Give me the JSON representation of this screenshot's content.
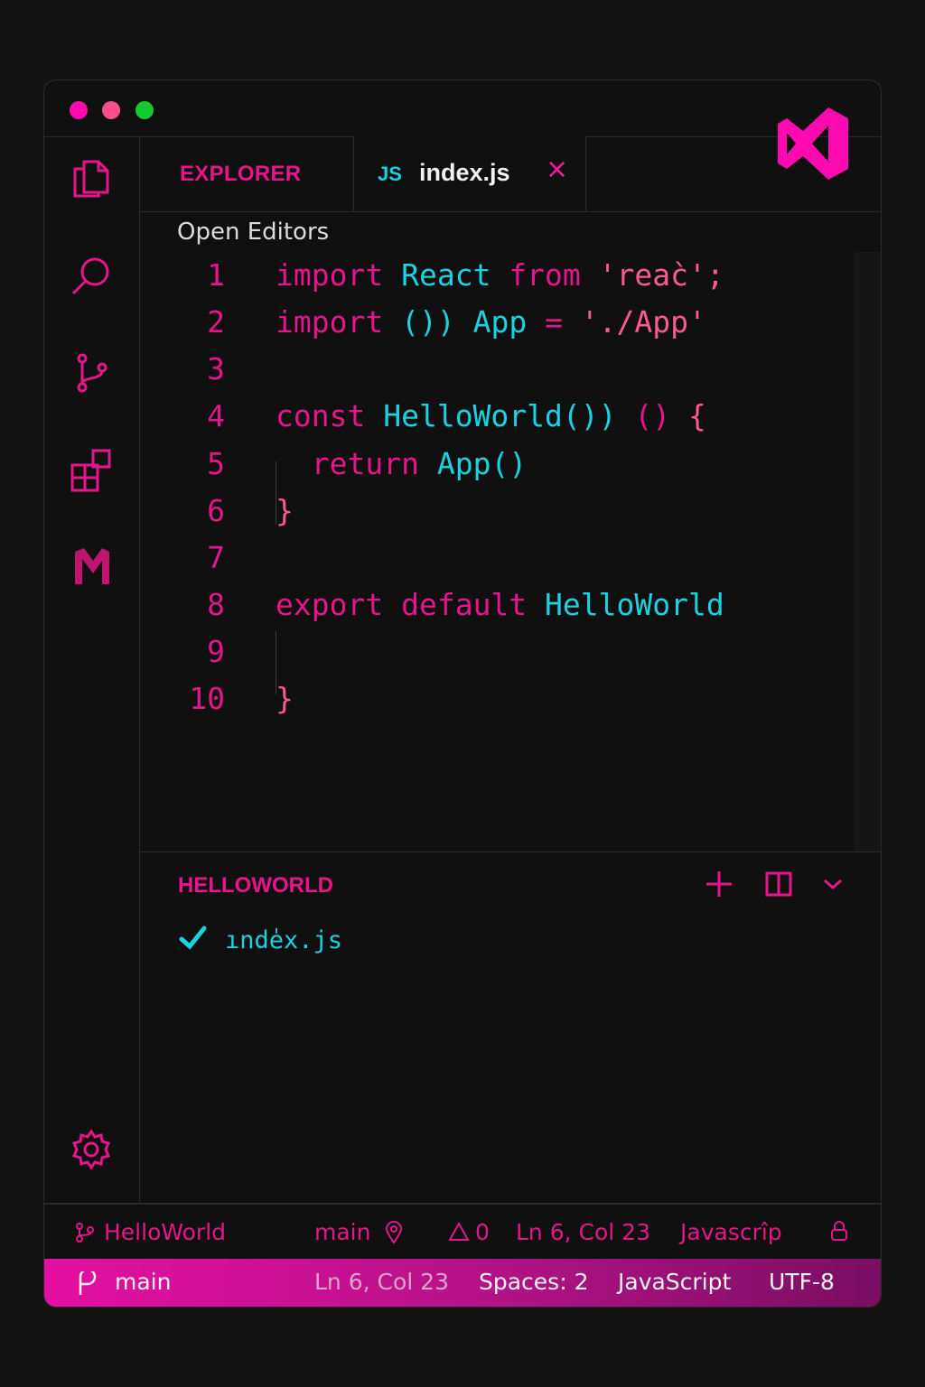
{
  "colors": {
    "accent": "#e5158a",
    "cyan": "#19d3e0",
    "string": "#ff5a8e",
    "close_dot": "#ff0ab0",
    "min_dot": "#ff4c8e",
    "max_dot": "#14c92c"
  },
  "window": {
    "controls": [
      "close",
      "minimize",
      "maximize"
    ]
  },
  "activity_bar": {
    "icons": [
      "files-icon",
      "search-icon",
      "source-control-icon",
      "extensions-icon",
      "m-logo-icon",
      "gear-icon"
    ]
  },
  "tabs": {
    "explorer_label": "EXPLORER",
    "file_lang": "JS",
    "file_name": "index.js",
    "close_glyph": "×"
  },
  "sidebar": {
    "open_editors_label": "Open Editors"
  },
  "editor": {
    "lines": [
      {
        "num": "1",
        "tokens": [
          {
            "t": "import",
            "c": "pink"
          },
          {
            "t": " "
          },
          {
            "t": "React",
            "c": "cyan"
          },
          {
            "t": " "
          },
          {
            "t": "from",
            "c": "pink"
          },
          {
            "t": " "
          },
          {
            "t": "'reac̀';",
            "c": "red"
          }
        ]
      },
      {
        "num": "2",
        "tokens": [
          {
            "t": "import",
            "c": "pink"
          },
          {
            "t": " "
          },
          {
            "t": "())",
            "c": "cyan"
          },
          {
            "t": " "
          },
          {
            "t": "App",
            "c": "cyan"
          },
          {
            "t": " "
          },
          {
            "t": "=",
            "c": "pink"
          },
          {
            "t": " "
          },
          {
            "t": "'./App'",
            "c": "red"
          }
        ]
      },
      {
        "num": "3",
        "tokens": []
      },
      {
        "num": "4",
        "tokens": [
          {
            "t": "const",
            "c": "pink"
          },
          {
            "t": " "
          },
          {
            "t": "HelloWorld())",
            "c": "cyan"
          },
          {
            "t": " "
          },
          {
            "t": "()",
            "c": "pink"
          },
          {
            "t": " "
          },
          {
            "t": "{",
            "c": "red"
          }
        ]
      },
      {
        "num": "5",
        "tokens": [
          {
            "t": "  "
          },
          {
            "t": "return",
            "c": "pink"
          },
          {
            "t": " "
          },
          {
            "t": "App()",
            "c": "cyan"
          }
        ]
      },
      {
        "num": "6",
        "tokens": [
          {
            "t": "}",
            "c": "red"
          }
        ]
      },
      {
        "num": "7",
        "tokens": []
      },
      {
        "num": "8",
        "tokens": [
          {
            "t": "export",
            "c": "pink"
          },
          {
            "t": " "
          },
          {
            "t": "default",
            "c": "pink"
          },
          {
            "t": " "
          },
          {
            "t": "HelloWorld",
            "c": "cyan"
          }
        ]
      },
      {
        "num": "9",
        "tokens": []
      },
      {
        "num": "10",
        "tokens": [
          {
            "t": "}",
            "c": "red"
          }
        ]
      }
    ]
  },
  "panel": {
    "title": "HELLOWORLD",
    "actions": [
      "plus-icon",
      "split-icon",
      "chevron-down-icon"
    ],
    "files": [
      {
        "name": "ınde̍x.js",
        "status": "check-icon"
      }
    ]
  },
  "status_top": {
    "repo": "HelloWorld",
    "branch": "main",
    "problems": "0",
    "position": "Ln 6, Col 23",
    "language": "Javascrı̂p"
  },
  "status_bottom": {
    "branch": "main",
    "position": "Ln 6, Col 23",
    "spaces": "Spaces: 2",
    "language": "JavaScript",
    "encoding": "UTF-8"
  }
}
